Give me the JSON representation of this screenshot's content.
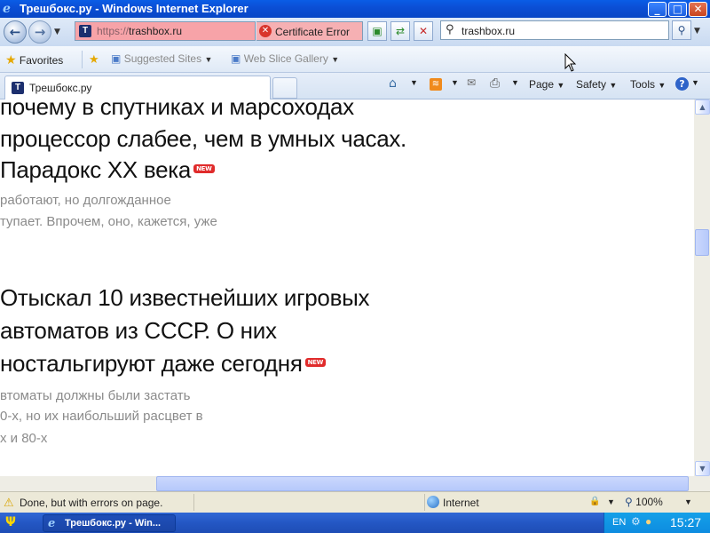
{
  "window": {
    "title": "Трешбокс.ру - Windows Internet Explorer",
    "controls": {
      "minimize": "_",
      "maximize": "□",
      "close": "✕"
    }
  },
  "nav": {
    "back_icon": "back-arrow-icon",
    "forward_icon": "forward-arrow-icon",
    "url_prefix": "https://",
    "url_host": "trashbox.ru",
    "favicon_letter": "T",
    "cert_error_label": "Certificate Error",
    "search_value": "trashbox.ru"
  },
  "favorites_bar": {
    "favorites_label": "Favorites",
    "suggested_sites_label": "Suggested Sites",
    "web_slice_gallery_label": "Web Slice Gallery"
  },
  "tabs": [
    {
      "label": "Трешбокс.ру"
    }
  ],
  "command_bar": {
    "page_label": "Page",
    "safety_label": "Safety",
    "tools_label": "Tools"
  },
  "articles": [
    {
      "title_lines": [
        "почему в спутниках и марсоходах",
        "процессор слабее, чем в умных часах.",
        "Парадокс XX века"
      ],
      "badge": "NEW",
      "lead_lines": [
        "работают, но долгожданное",
        "тупает. Впрочем, оно, кажется, уже"
      ]
    },
    {
      "title_lines": [
        "Отыскал 10 известнейших игровых",
        "автоматов из СССР. О них",
        "ностальгируют даже сегодня"
      ],
      "badge": "NEW",
      "lead_lines": [
        "втоматы должны были застать",
        "0-х, но их наибольший расцвет в",
        "х и 80-х"
      ]
    }
  ],
  "status_bar": {
    "message": "Done, but with errors on page.",
    "zone": "Internet",
    "zoom": "100%"
  },
  "taskbar": {
    "window_button": "Трешбокс.ру - Win...",
    "lang": "EN",
    "clock": "15:27"
  },
  "colors": {
    "titlebar": "#0b4fd6",
    "url_error_bg": "#f7a3a8",
    "new_badge": "#e02b2b",
    "lead_text": "#8b8b8b"
  }
}
